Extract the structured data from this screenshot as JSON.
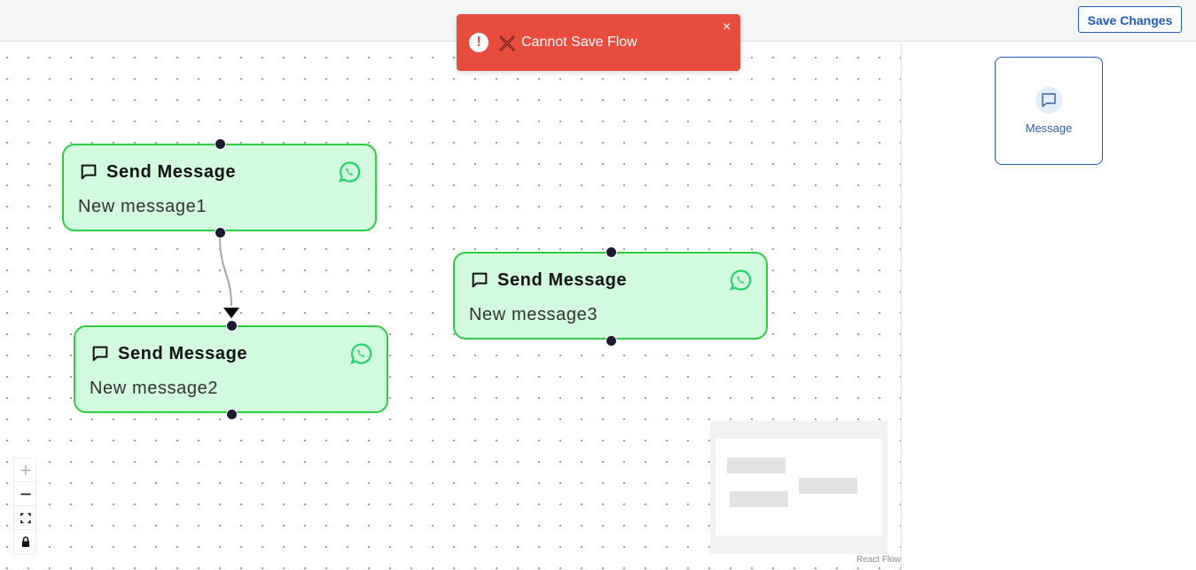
{
  "toolbar": {
    "save_label": "Save Changes"
  },
  "toast": {
    "message": "Cannot Save Flow",
    "close": "×",
    "alert": "!"
  },
  "nodes": [
    {
      "title": "Send Message",
      "text": "New message1"
    },
    {
      "title": "Send Message",
      "text": "New message2"
    },
    {
      "title": "Send Message",
      "text": "New message3"
    }
  ],
  "panel": {
    "message_label": "Message"
  },
  "canvas": {
    "attribution": "React Flow"
  },
  "colors": {
    "accent": "#1d5bbf",
    "node_bg": "#d1fadf",
    "node_border": "#2ecc40",
    "toast_bg": "#e74c3c",
    "whatsapp": "#25d366"
  },
  "icons": {
    "node_header": "message-square-icon",
    "node_channel": "whatsapp-icon",
    "toast_alert": "alert-circle-icon",
    "toast_error": "x-mark-icon",
    "controls": [
      "zoom-in-icon",
      "zoom-out-icon",
      "fit-view-icon",
      "lock-icon"
    ]
  }
}
